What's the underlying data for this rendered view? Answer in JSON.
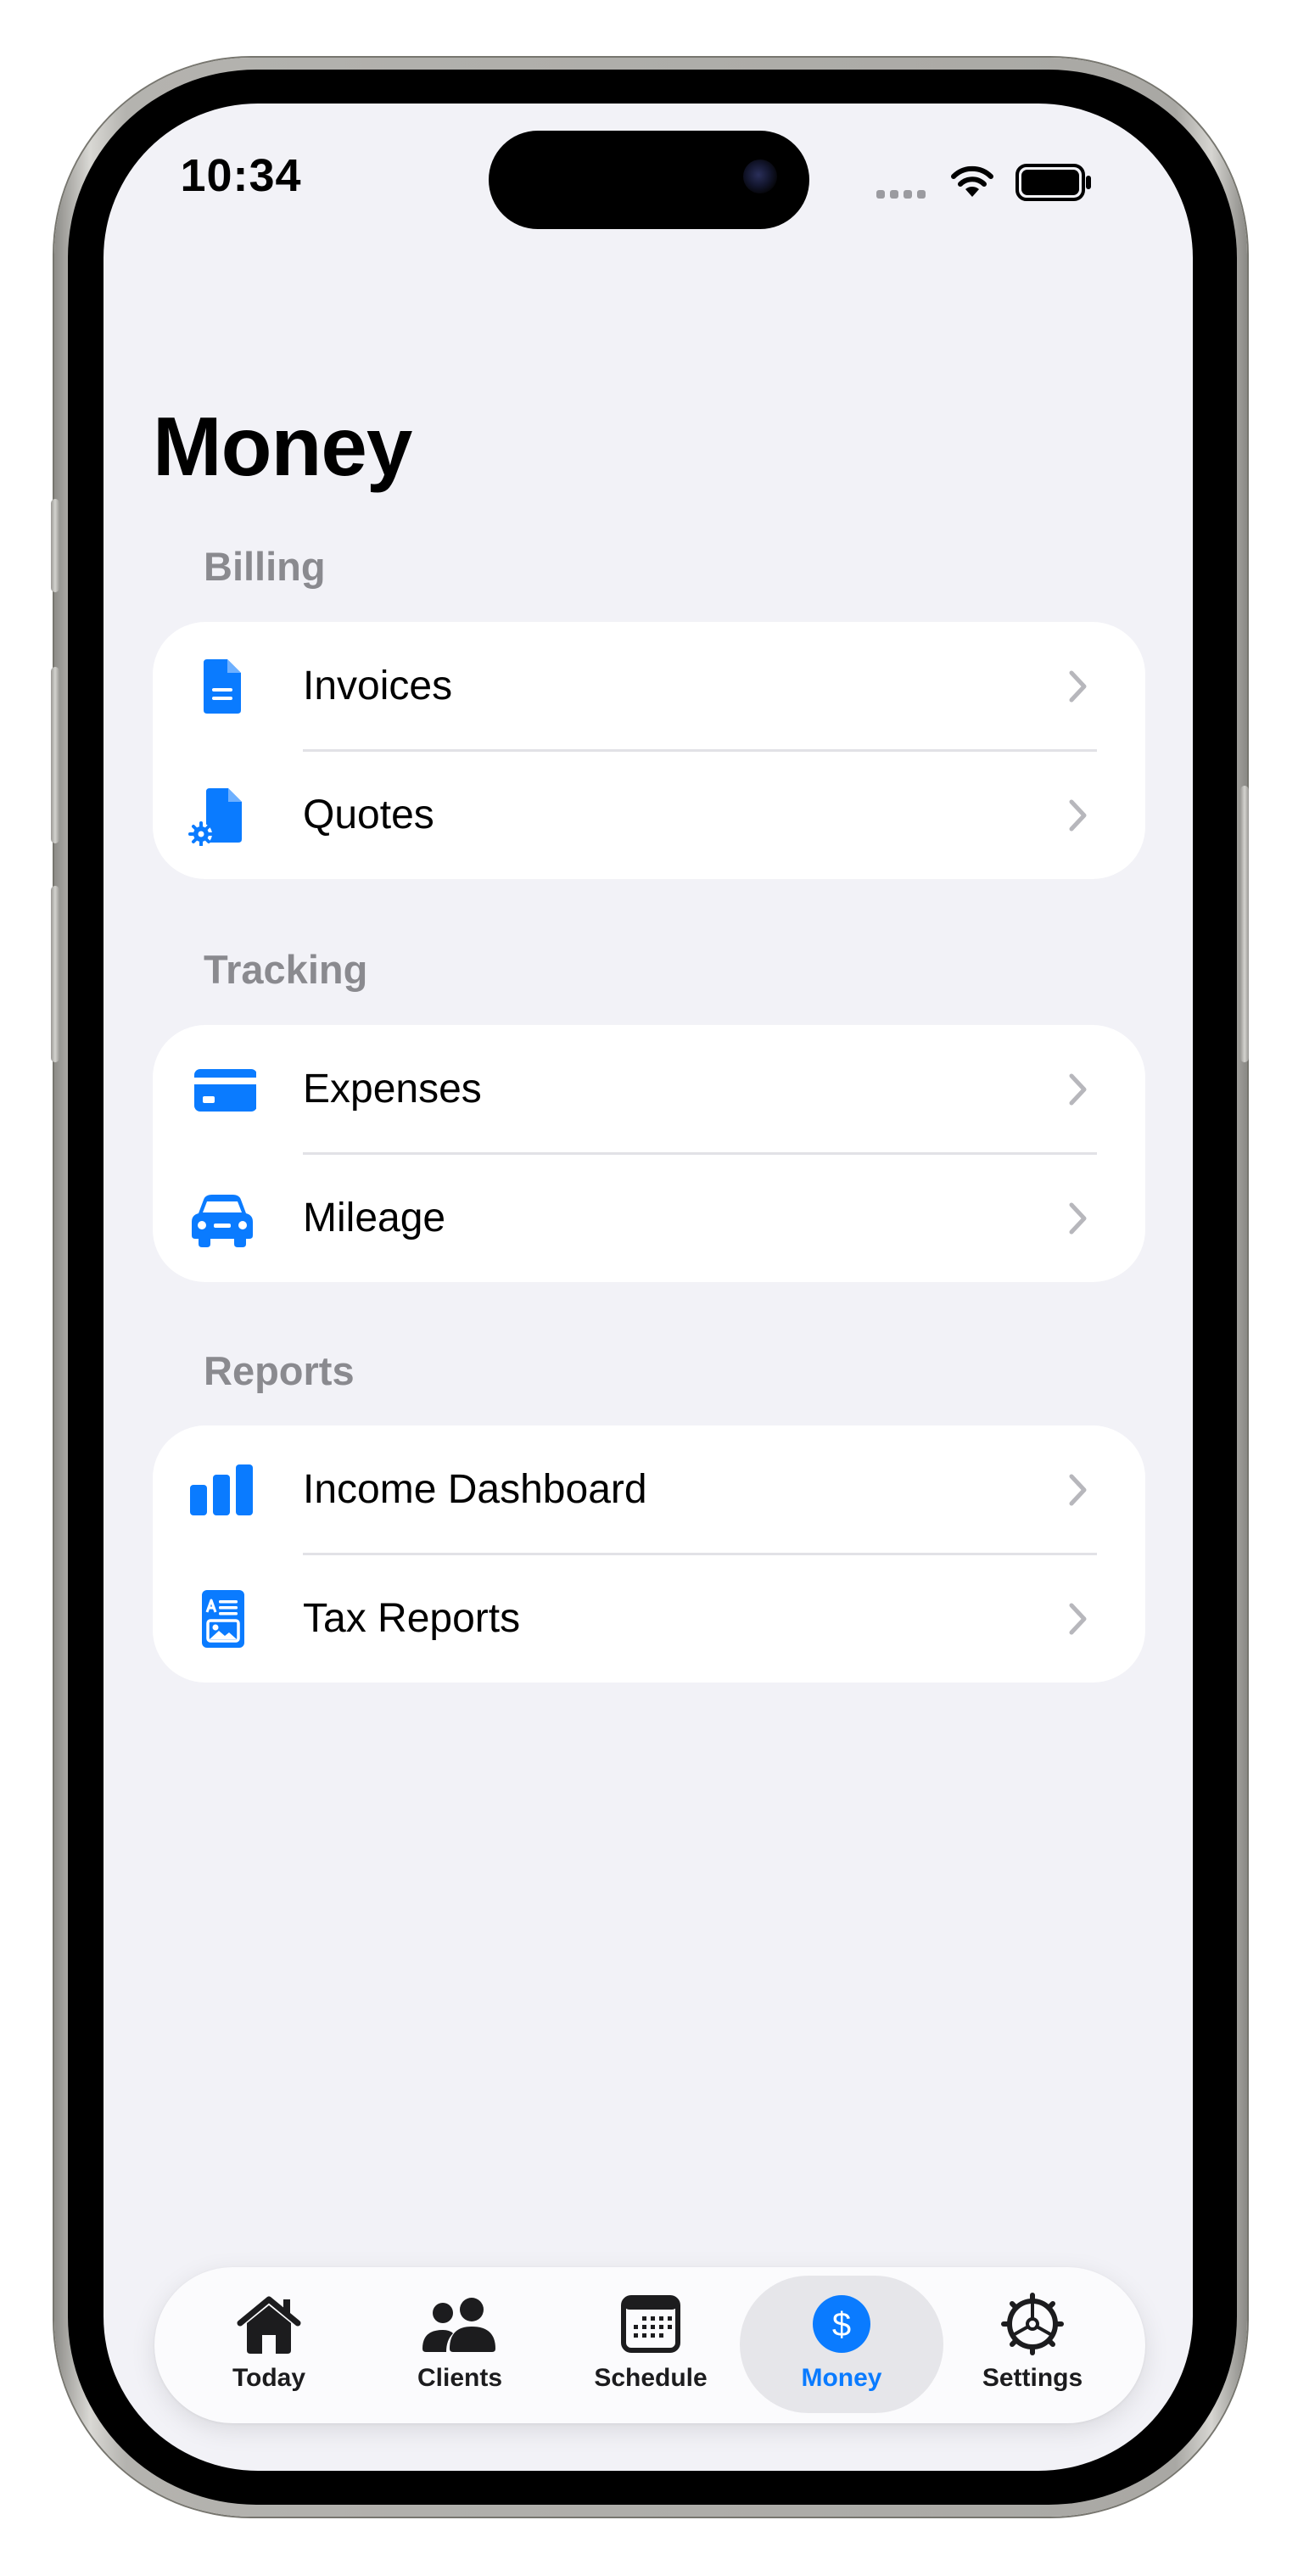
{
  "status_bar": {
    "time": "10:34"
  },
  "page": {
    "title": "Money"
  },
  "sections": [
    {
      "header": "Billing",
      "items": [
        {
          "label": "Invoices",
          "icon": "document-icon"
        },
        {
          "label": "Quotes",
          "icon": "document-gear-icon"
        }
      ]
    },
    {
      "header": "Tracking",
      "items": [
        {
          "label": "Expenses",
          "icon": "credit-card-icon"
        },
        {
          "label": "Mileage",
          "icon": "car-icon"
        }
      ]
    },
    {
      "header": "Reports",
      "items": [
        {
          "label": "Income Dashboard",
          "icon": "bar-chart-icon"
        },
        {
          "label": "Tax Reports",
          "icon": "tax-report-icon"
        }
      ]
    }
  ],
  "tab_bar": {
    "selected": "Money",
    "tabs": [
      {
        "label": "Today",
        "icon": "house-icon"
      },
      {
        "label": "Clients",
        "icon": "people-icon"
      },
      {
        "label": "Schedule",
        "icon": "calendar-icon"
      },
      {
        "label": "Money",
        "icon": "dollar-circle-icon"
      },
      {
        "label": "Settings",
        "icon": "gear-icon"
      }
    ]
  },
  "colors": {
    "accent": "#0a7bff",
    "background": "#f2f2f7",
    "secondary_text": "#8a8a8f",
    "card": "#ffffff"
  }
}
